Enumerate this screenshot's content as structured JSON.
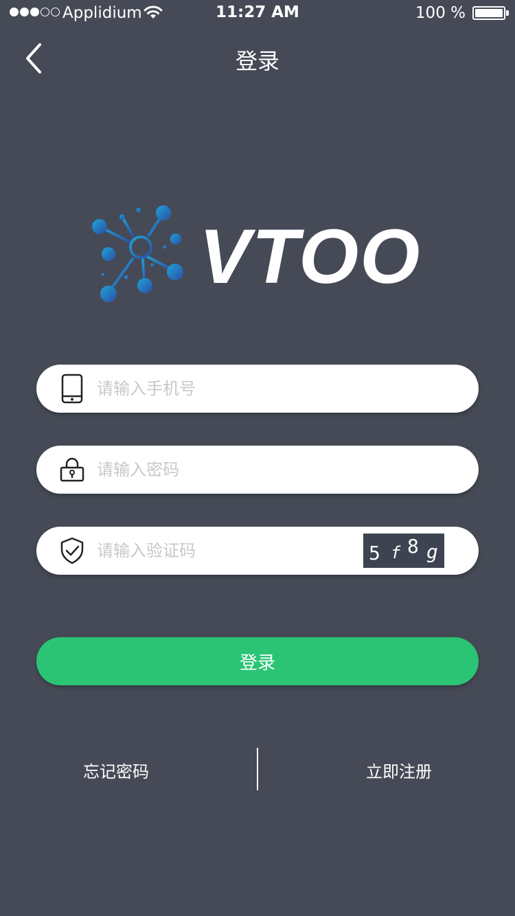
{
  "status_bar": {
    "carrier": "Applidium",
    "time": "11:27 AM",
    "battery": "100 %",
    "signal_filled": 3,
    "signal_total": 5
  },
  "nav": {
    "title": "登录",
    "back_icon": "chevron-left-icon"
  },
  "logo": {
    "text": "VTOO",
    "mark_colors": [
      "#1f9bd0",
      "#2a5cab"
    ]
  },
  "form": {
    "phone_placeholder": "请输入手机号",
    "password_placeholder": "请输入密码",
    "captcha_placeholder": "请输入验证码",
    "captcha_chars": [
      "5",
      "f",
      "8",
      "g"
    ]
  },
  "login_button": "登录",
  "links": {
    "forgot_password": "忘记密码",
    "register": "立即注册"
  },
  "colors": {
    "background": "#454a56",
    "primary": "#2bc475",
    "captcha_bg": "#3d4350"
  }
}
